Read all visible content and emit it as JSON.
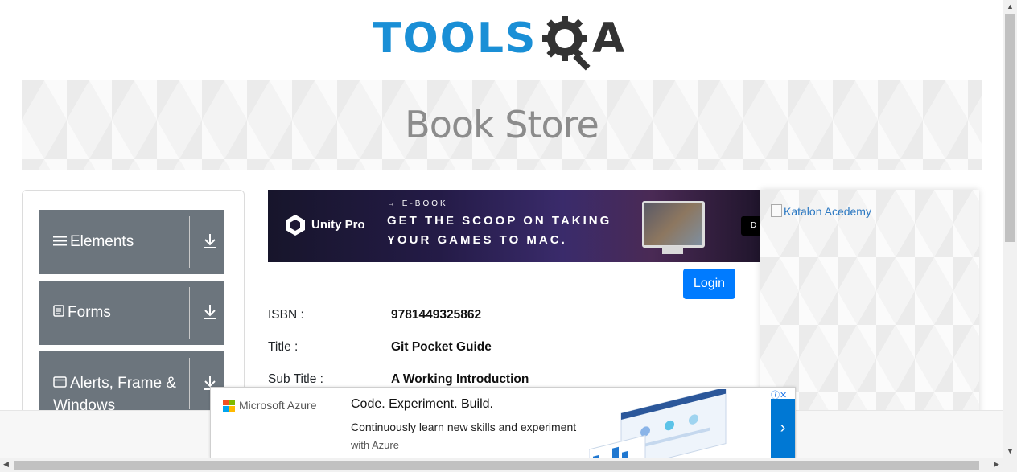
{
  "logo": {
    "tools_text": "TOOLS",
    "a_text": "A"
  },
  "banner": {
    "title": "Book Store"
  },
  "sidebar": {
    "groups": [
      {
        "label": "Elements",
        "icon": "hamburger-icon"
      },
      {
        "label": "Forms",
        "icon": "form-icon"
      },
      {
        "label": "Alerts, Frame & Windows",
        "icon": "window-icon"
      }
    ]
  },
  "top_ad": {
    "brand": "Unity Pro",
    "kicker": "→ E-BOOK",
    "line1": "GET THE SCOOP ON TAKING",
    "line2": "YOUR GAMES TO MAC.",
    "cta": "D"
  },
  "login_button": "Login",
  "book": {
    "rows": [
      {
        "key": "ISBN :",
        "value": "9781449325862"
      },
      {
        "key": "Title :",
        "value": "Git Pocket Guide"
      },
      {
        "key": "Sub Title :",
        "value": "A Working Introduction"
      }
    ]
  },
  "right_ad": {
    "alt": "Katalon Acedemy"
  },
  "bottom_ad": {
    "brand": "Microsoft Azure",
    "headline": "Code. Experiment. Build.",
    "desc1": "Continuously learn new skills and experiment",
    "desc2": "with Azure",
    "next_label": "›"
  },
  "colors": {
    "accent": "#007bff",
    "sidebar_bg": "#6c757d",
    "logo_blue": "#1a8fd6",
    "azure_blue": "#0078d4"
  }
}
